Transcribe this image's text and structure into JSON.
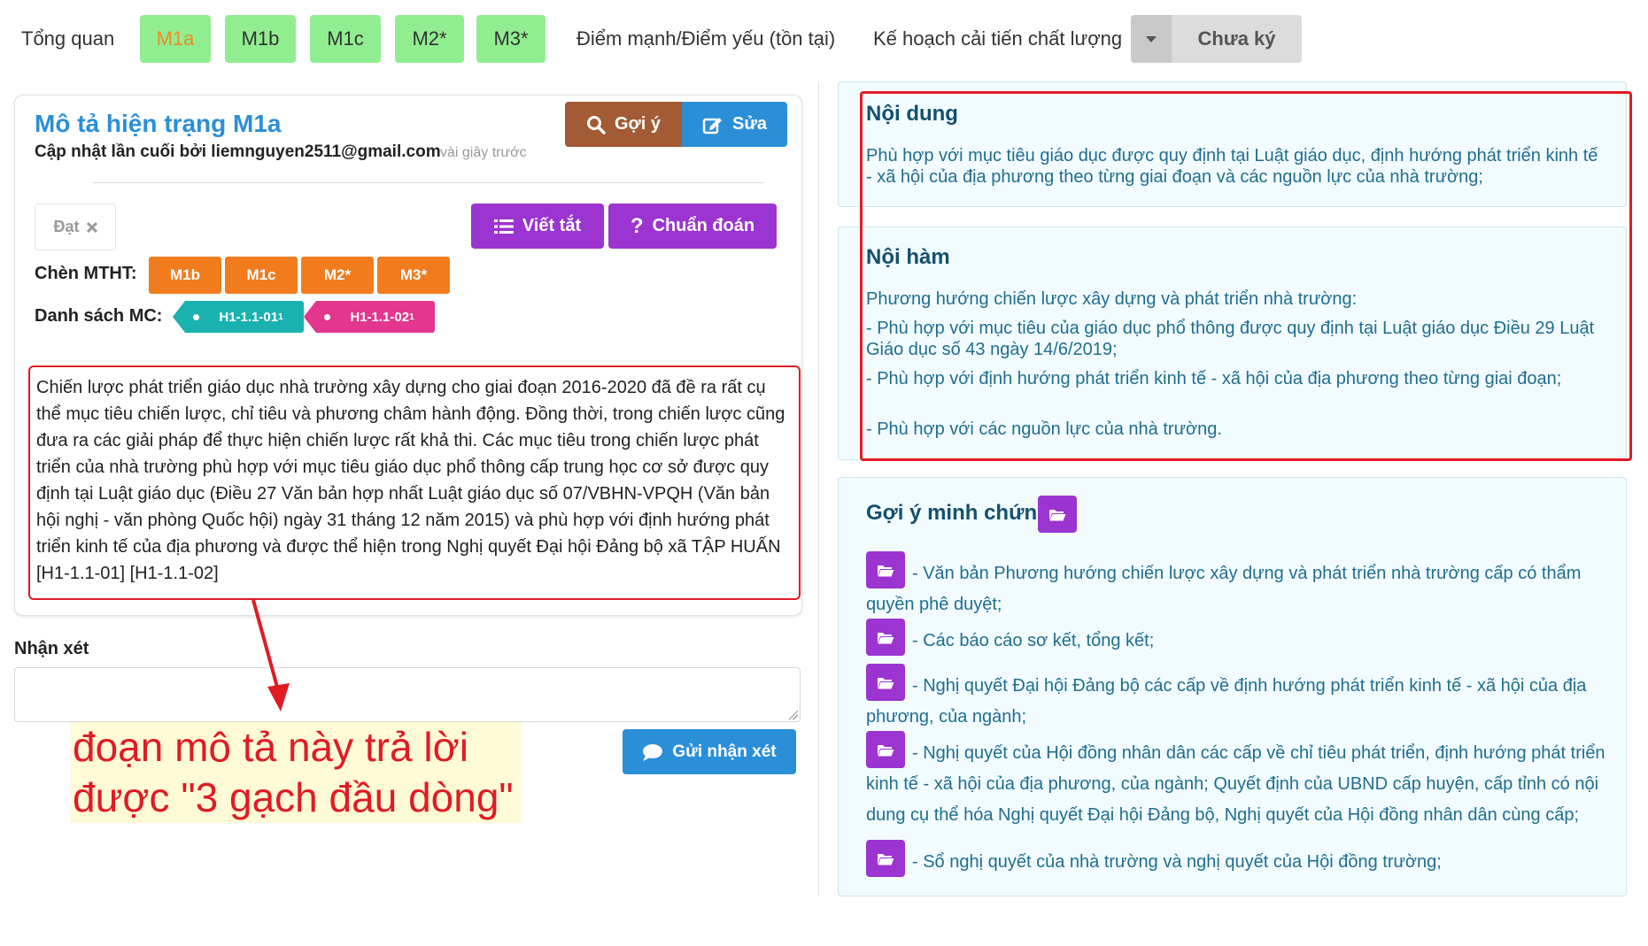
{
  "nav": {
    "overview": "Tổng quan",
    "tabs": [
      "M1a",
      "M1b",
      "M1c",
      "M2*",
      "M3*"
    ],
    "active_tab": "M1a",
    "strengths": "Điểm mạnh/Điểm yếu (tồn tại)",
    "plan": "Kế hoạch cải tiến chất lượng",
    "sign_status": "Chưa ký"
  },
  "left": {
    "title": "Mô tả hiện trạng M1a",
    "updated_by": "Cập nhật lần cuối bởi liemnguyen2511@gmail.com",
    "updated_ago": "vài giây trước",
    "btn_suggest": "Gợi ý",
    "btn_edit": "Sửa",
    "status_tag": "Đạt",
    "btn_abbrev": "Viết tắt",
    "btn_diagnose": "Chuẩn đoán",
    "insert_label": "Chèn MTHT:",
    "insert_items": [
      "M1b",
      "M1c",
      "M2*",
      "M3*"
    ],
    "mc_label": "Danh sách MC:",
    "mc_items": [
      "H1-1.1-01",
      "H1-1.1-02"
    ],
    "mc_subscript": "1",
    "description": "Chiến lược phát triển giáo dục nhà trường xây dựng cho giai đoạn 2016-2020 đã đề ra rất cụ thể mục tiêu chiến lược, chỉ tiêu và phương châm hành động. Đồng thời, trong chiến lược cũng đưa ra các giải pháp để thực hiện chiến lược rất khả thi. Các mục tiêu trong chiến lược phát triển của nhà trường phù hợp với mục tiêu giáo dục phổ thông cấp trung học cơ sở được quy định tại Luật giáo dục (Điều 27 Văn bản hợp nhất Luật giáo dục số 07/VBHN-VPQH (Văn bản hội nghị - văn phòng Quốc hội) ngày 31 tháng 12 năm 2015) và phù hợp với định hướng phát triển kinh tế của địa phương và được thể hiện trong Nghị quyết Đại hội Đảng bộ xã TẬP HUẤN [H1-1.1-01] [H1-1.1-02]",
    "comment_label": "Nhận xét",
    "comment_value": "",
    "btn_send": "Gửi nhận xét"
  },
  "annotation": {
    "line1": "đoạn mô tả này trả lời",
    "line2": "được \"3 gạch đầu dòng\""
  },
  "right": {
    "content_title": "Nội dung",
    "content_text": "Phù hợp với mục tiêu giáo dục được quy định tại Luật giáo dục, định hướng phát triển kinh tế - xã hội của địa phương theo từng giai đoạn và các nguồn lực của nhà trường;",
    "implication_title": "Nội hàm",
    "implication_lines": [
      "Phương hướng chiến lược xây dựng và phát triển nhà trường:",
      "- Phù hợp với mục tiêu của giáo dục phổ thông được quy định tại Luật giáo dục Điều 29 Luật Giáo dục số 43 ngày 14/6/2019;",
      "- Phù hợp với định hướng phát triển kinh tế - xã hội của địa phương theo từng giai đoạn;",
      "- Phù hợp với các nguồn lực của nhà trường."
    ],
    "evidence_title": "Gợi ý minh chứng",
    "evidence_items": [
      "- Văn bản Phương hướng chiến lược xây dựng và phát triển nhà trường cấp có thẩm quyền phê duyệt;",
      "- Các báo cáo sơ kết, tổng kết;",
      "- Nghị quyết Đại hội Đảng bộ các cấp về định hướng phát triển kinh tế - xã hội của địa phương, của ngành;",
      "- Nghị quyết của Hội đồng nhân dân các cấp về chỉ tiêu phát triển, định hướng phát triển kinh tế - xã hội của địa phương, của ngành; Quyết định của UBND cấp huyện, cấp tỉnh có nội dung cụ thể hóa Nghị quyết Đại hội Đảng bộ, Nghị quyết của Hội đồng nhân dân cùng cấp;",
      "- Sổ nghị quyết của nhà trường và nghị quyết của Hội đồng trường;"
    ]
  },
  "colors": {
    "tab_green": "#90ee90",
    "title_blue": "#2a8fd6",
    "purple": "#9b34d0",
    "orange": "#f07c1e",
    "teal": "#1ab2b0",
    "pink": "#e2368f",
    "brown": "#a25b34",
    "highlight_red": "#e01b24"
  },
  "icons": {
    "suggest": "search-icon",
    "edit": "edit-icon",
    "remove": "close-icon",
    "abbrev": "list-icon",
    "diagnose": "question-icon",
    "send": "comment-icon",
    "dropdown": "chevron-down-icon",
    "evidence": "folder-open-icon"
  }
}
